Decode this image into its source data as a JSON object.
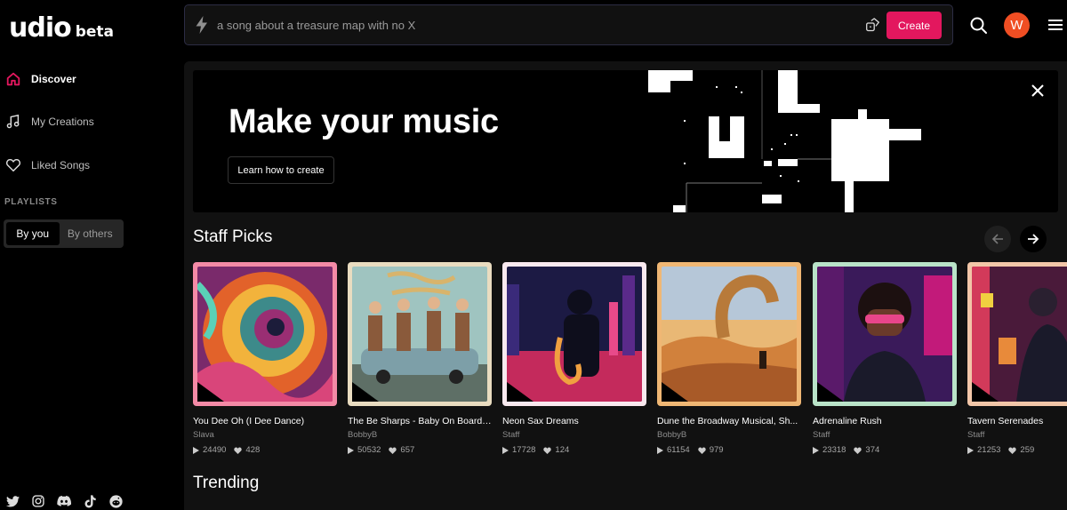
{
  "app": {
    "logo": "udio",
    "badge": "beta"
  },
  "sidebar": {
    "nav": [
      {
        "label": "Discover",
        "icon": "home-icon"
      },
      {
        "label": "My Creations",
        "icon": "music-note-icon"
      },
      {
        "label": "Liked Songs",
        "icon": "heart-icon"
      }
    ],
    "playlists_heading": "PLAYLISTS",
    "filter": {
      "selected": "By you",
      "other": "By others"
    },
    "social_icons": [
      "twitter-icon",
      "instagram-icon",
      "discord-icon",
      "tiktok-icon",
      "reddit-icon"
    ]
  },
  "topbar": {
    "search_placeholder": "a song about a treasure map with no X",
    "create_label": "Create",
    "avatar_initial": "W"
  },
  "banner": {
    "title": "Make your music",
    "cta": "Learn how to create"
  },
  "sections": {
    "staff_picks": "Staff Picks",
    "trending": "Trending"
  },
  "cards": [
    {
      "title": "You Dee Oh (I Dee Dance)",
      "artist": "Slava",
      "plays": "24490",
      "likes": "428",
      "border": "#f48aa6"
    },
    {
      "title": "The Be Sharps - Baby On Board,...",
      "artist": "BobbyB",
      "plays": "50532",
      "likes": "657",
      "border": "#e9dcc0"
    },
    {
      "title": "Neon Sax Dreams",
      "artist": "Staff",
      "plays": "17728",
      "likes": "124",
      "border": "#f9e9ef"
    },
    {
      "title": "Dune the Broadway Musical, Sh...",
      "artist": "BobbyB",
      "plays": "61154",
      "likes": "979",
      "border": "#f0b774"
    },
    {
      "title": "Adrenaline Rush",
      "artist": "Staff",
      "plays": "23318",
      "likes": "374",
      "border": "#b9e3c8"
    },
    {
      "title": "Tavern Serenades",
      "artist": "Staff",
      "plays": "21253",
      "likes": "259",
      "border": "#f2c6a8"
    }
  ]
}
